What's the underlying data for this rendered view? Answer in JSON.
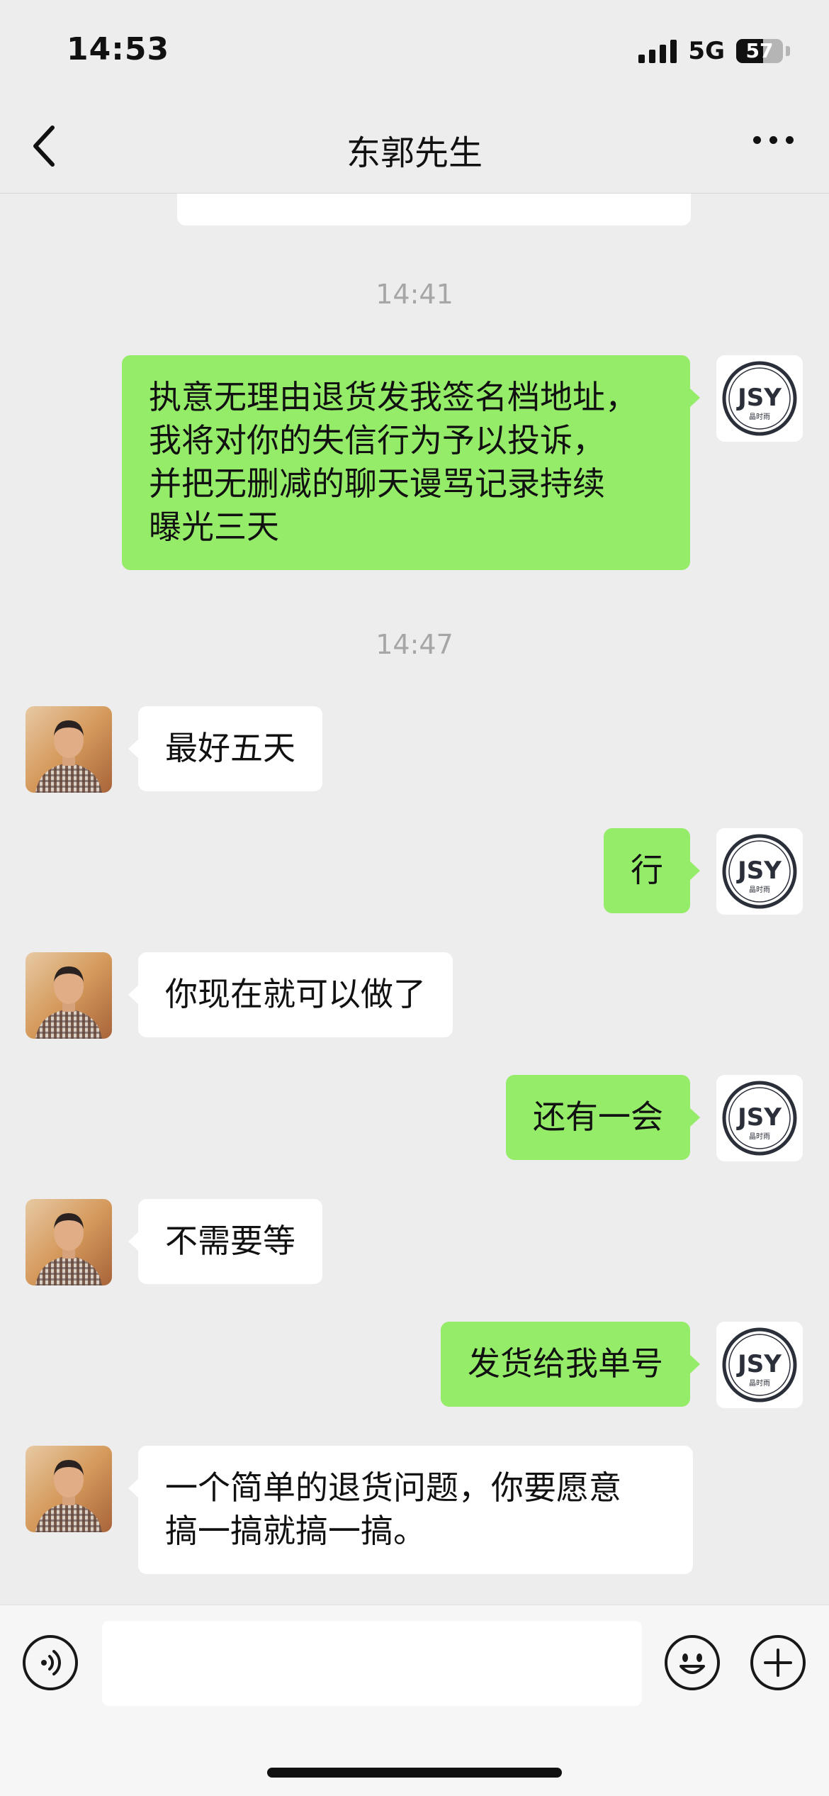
{
  "status_bar": {
    "time": "14:53",
    "network": "5G",
    "battery": "57",
    "battery_level": 0.57
  },
  "nav": {
    "title": "东郭先生",
    "back_icon": "chevron-left-icon",
    "more_icon": "more-dots-icon"
  },
  "chat": {
    "timestamps": [
      "14:41",
      "14:47"
    ],
    "messages": [
      {
        "from": "me",
        "text": "执意无理由退货发我签名档地址，\n我将对你的失信行为予以投诉，\n并把无删减的聊天谩骂记录持续\n曝光三天"
      },
      {
        "from": "other",
        "text": "最好五天"
      },
      {
        "from": "me",
        "text": "行"
      },
      {
        "from": "other",
        "text": "你现在就可以做了"
      },
      {
        "from": "me",
        "text": "还有一会"
      },
      {
        "from": "other",
        "text": "不需要等"
      },
      {
        "from": "me",
        "text": "发货给我单号"
      },
      {
        "from": "other",
        "text": "一个简单的退货问题，你要愿意\n搞一搞就搞一搞。"
      }
    ],
    "my_avatar_logo_text": "JSY",
    "my_avatar_logo_subtext": "晶时雨"
  },
  "input_bar": {
    "placeholder": "",
    "voice_icon": "voice-icon",
    "emoji_icon": "emoji-icon",
    "plus_icon": "plus-icon"
  },
  "colors": {
    "background": "#ededed",
    "outgoing_bubble": "#95ec69",
    "incoming_bubble": "#ffffff",
    "timestamp": "#a6a6a6"
  }
}
